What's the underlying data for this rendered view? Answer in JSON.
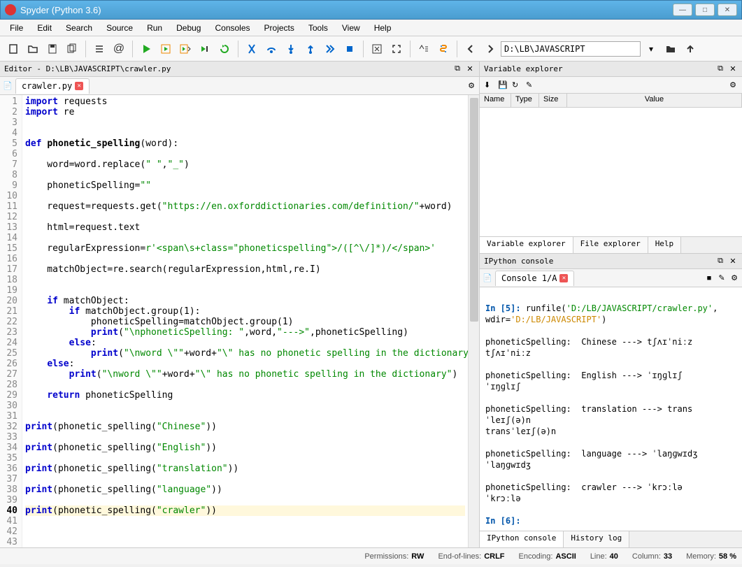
{
  "window": {
    "title": "Spyder (Python 3.6)"
  },
  "menu": [
    "File",
    "Edit",
    "Search",
    "Source",
    "Run",
    "Debug",
    "Consoles",
    "Projects",
    "Tools",
    "View",
    "Help"
  ],
  "toolbar": {
    "path": "D:\\LB\\JAVASCRIPT"
  },
  "editor": {
    "header": "Editor - D:\\LB\\JAVASCRIPT\\crawler.py",
    "tab": "crawler.py"
  },
  "code_lines": 43,
  "var_explorer": {
    "title": "Variable explorer",
    "cols": [
      "Name",
      "Type",
      "Size",
      "Value"
    ],
    "tabs": [
      "Variable explorer",
      "File explorer",
      "Help"
    ]
  },
  "console": {
    "title": "IPython console",
    "tab": "Console 1/A",
    "in5": "In [5]:",
    "runfile": " runfile(",
    "path1": "'D:/LB/JAVASCRIPT/crawler.py'",
    "comma": ", wdir=",
    "path2": "'D:/LB/JAVASCRIPT'",
    "close": ")",
    "out1": "phoneticSpelling:  Chinese ---> tʃʌɪˈniːz\ntʃʌɪˈniːz",
    "out2": "phoneticSpelling:  English ---> ˈɪŋɡlɪʃ\nˈɪŋɡlɪʃ",
    "out3": "phoneticSpelling:  translation ---> transˈleɪʃ(ə)n\ntransˈleɪʃ(ə)n",
    "out4": "phoneticSpelling:  language ---> ˈlaŋɡwɪdʒ\nˈlaŋɡwɪdʒ",
    "out5": "phoneticSpelling:  crawler ---> ˈkrɔːlə\nˈkrɔːlə",
    "in6": "In [6]:",
    "tabs": [
      "IPython console",
      "History log"
    ]
  },
  "status": {
    "perm_l": "Permissions:",
    "perm_v": "RW",
    "eol_l": "End-of-lines:",
    "eol_v": "CRLF",
    "enc_l": "Encoding:",
    "enc_v": "ASCII",
    "line_l": "Line:",
    "line_v": "40",
    "col_l": "Column:",
    "col_v": "33",
    "mem_l": "Memory:",
    "mem_v": "58 %"
  }
}
